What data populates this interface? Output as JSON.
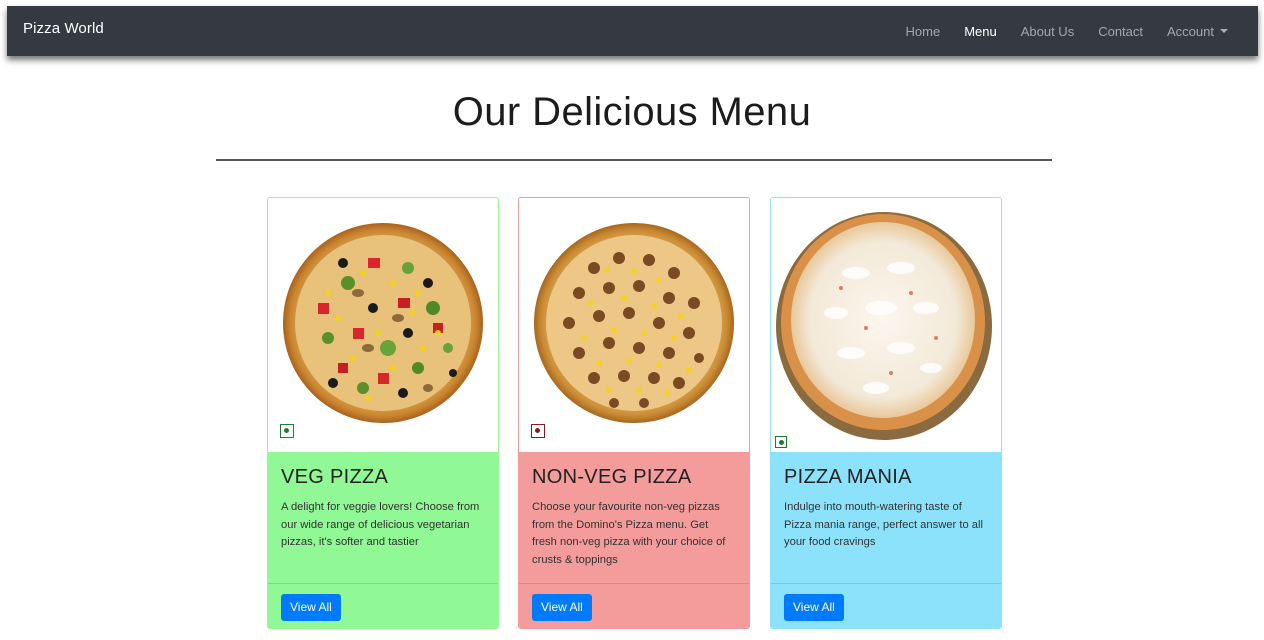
{
  "navbar": {
    "brand": "Pizza World",
    "links": [
      {
        "label": "Home",
        "active": false
      },
      {
        "label": "Menu",
        "active": true
      },
      {
        "label": "About Us",
        "active": false
      },
      {
        "label": "Contact",
        "active": false
      },
      {
        "label": "Account",
        "active": false,
        "dropdown": true
      }
    ]
  },
  "page": {
    "title": "Our Delicious Menu"
  },
  "cards": [
    {
      "title": "VEG PIZZA",
      "text": "A delight for veggie lovers! Choose from our wide range of delicious vegetarian pizzas, it's softer and tastier",
      "button": "View All",
      "badge": "veg-mark-icon",
      "body_color": "#90f894",
      "border_color": "#90f894"
    },
    {
      "title": "NON-VEG PIZZA",
      "text": "Choose your favourite non-veg pizzas from the Domino's Pizza menu. Get fresh non-veg pizza with your choice of crusts & toppings",
      "button": "View All",
      "badge": "nonveg-mark-icon",
      "body_color": "#f39c9b",
      "border_color": "#f39c9b"
    },
    {
      "title": "PIZZA MANIA",
      "text": "Indulge into mouth-watering taste of Pizza mania range, perfect answer to all your food cravings",
      "button": "View All",
      "badge": "veg-mark-icon",
      "body_color": "#8de2fb",
      "border_color": "#8de2fb"
    }
  ]
}
